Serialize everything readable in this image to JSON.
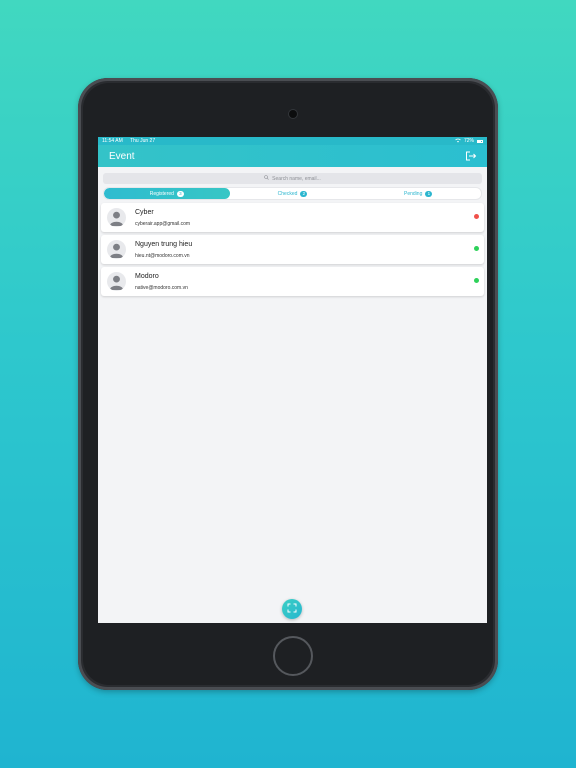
{
  "status_bar": {
    "time": "11:54 AM",
    "date": "Thu Jun 27",
    "battery": "72%"
  },
  "header": {
    "title": "Event",
    "logout_icon": "logout-icon"
  },
  "search": {
    "placeholder": "Search name, email..."
  },
  "tabs": [
    {
      "label": "Registered",
      "count": "3",
      "active": true
    },
    {
      "label": "Checked",
      "count": "2",
      "active": false
    },
    {
      "label": "Pending",
      "count": "1",
      "active": false
    }
  ],
  "attendees": [
    {
      "name": "Cyber",
      "email": "cyberair.app@gmail.com",
      "status_color": "#f0504a"
    },
    {
      "name": "Nguyen trung hieu",
      "email": "hieu.nt@modoro.com.vn",
      "status_color": "#2ed15a"
    },
    {
      "name": "Modoro",
      "email": "native@modoro.com.vn",
      "status_color": "#2ed15a"
    }
  ],
  "scan_button": {
    "icon": "scan-icon"
  },
  "colors": {
    "accent": "#2bbfd0",
    "background_top": "#41d8c0",
    "background_bottom": "#1fb4d0"
  }
}
